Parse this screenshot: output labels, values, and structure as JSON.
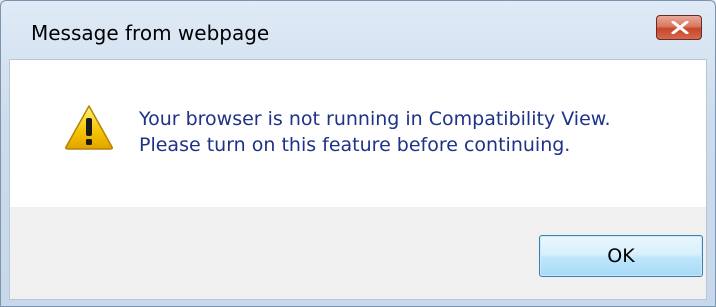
{
  "dialog": {
    "title": "Message from webpage",
    "close_icon": "close-icon",
    "warning_icon": "warning-icon",
    "message_lines": [
      "Your browser is not running in Compatibility View.",
      "Please turn on this feature before continuing."
    ],
    "ok_label": "OK"
  },
  "colors": {
    "message_text": "#1e3287",
    "close_button": "#c6472b",
    "warning_yellow": "#f5c400"
  }
}
